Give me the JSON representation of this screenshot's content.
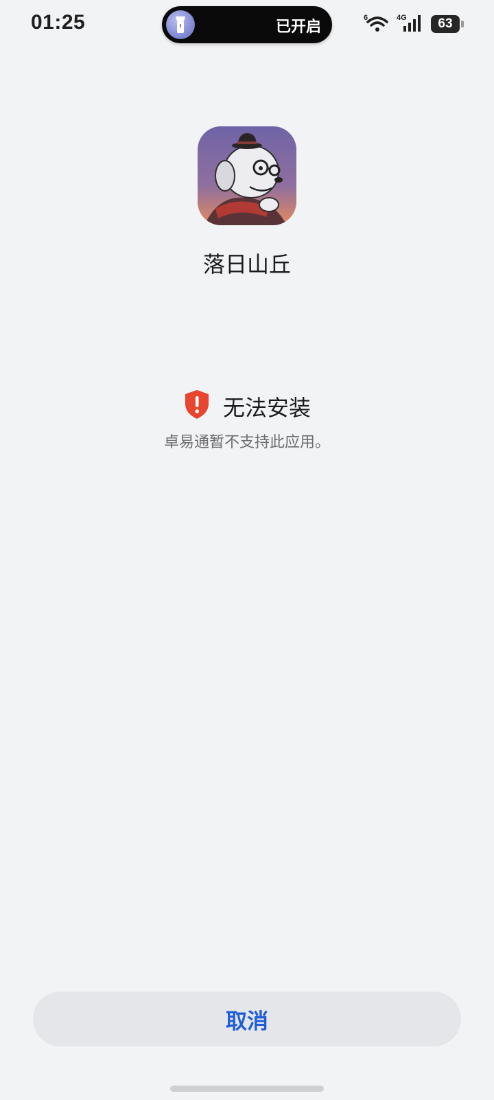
{
  "status_bar": {
    "time": "01:25",
    "island_text": "已开启",
    "island_icon": "flashlight-icon",
    "wifi_label": "6",
    "network_label": "4G",
    "battery": "63"
  },
  "app": {
    "name": "落日山丘",
    "icon": "app-icon-dog-illustration"
  },
  "error": {
    "icon": "shield-alert-icon",
    "icon_color": "#e8452f",
    "title": "无法安装",
    "message": "卓易通暂不支持此应用。"
  },
  "actions": {
    "cancel_label": "取消",
    "cancel_color": "#1f5ed6"
  }
}
